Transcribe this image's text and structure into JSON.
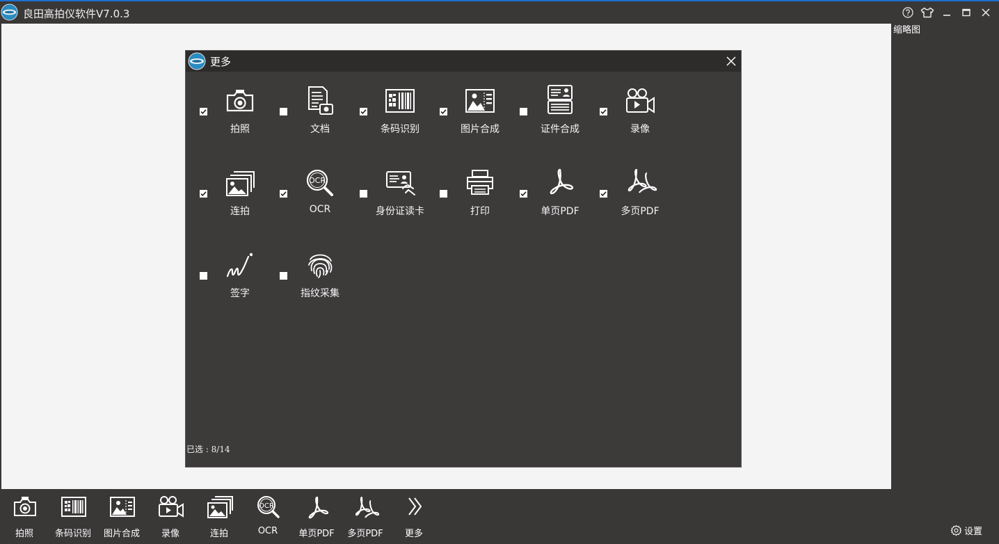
{
  "window": {
    "title": "良田高拍仪软件V7.0.3",
    "accent_color": "#1e6fd0",
    "controls": [
      "help-icon",
      "skin-icon",
      "minimize-icon",
      "maximize-icon",
      "close-icon"
    ]
  },
  "thumbnail_panel": {
    "label": "缩略图"
  },
  "toolbar": {
    "items": [
      {
        "label": "拍照",
        "icon": "camera-icon"
      },
      {
        "label": "条码识别",
        "icon": "barcode-icon"
      },
      {
        "label": "图片合成",
        "icon": "image-merge-icon"
      },
      {
        "label": "录像",
        "icon": "video-camera-icon"
      },
      {
        "label": "连拍",
        "icon": "burst-icon"
      },
      {
        "label": "OCR",
        "icon": "ocr-icon"
      },
      {
        "label": "单页PDF",
        "icon": "pdf-icon"
      },
      {
        "label": "多页PDF",
        "icon": "multi-pdf-icon"
      },
      {
        "label": "更多",
        "icon": "chevron-right-double-icon"
      }
    ],
    "settings_label": "设置"
  },
  "dialog": {
    "title": "更多",
    "status": "已选 : 8/14",
    "items": [
      {
        "label": "拍照",
        "checked": true,
        "icon": "camera-icon"
      },
      {
        "label": "文档",
        "checked": false,
        "icon": "document-camera-icon"
      },
      {
        "label": "条码识别",
        "checked": true,
        "icon": "barcode-icon"
      },
      {
        "label": "图片合成",
        "checked": true,
        "icon": "image-merge-icon"
      },
      {
        "label": "证件合成",
        "checked": false,
        "icon": "id-merge-icon"
      },
      {
        "label": "录像",
        "checked": true,
        "icon": "video-camera-icon"
      },
      {
        "label": "连拍",
        "checked": true,
        "icon": "burst-icon"
      },
      {
        "label": "OCR",
        "checked": true,
        "icon": "ocr-icon"
      },
      {
        "label": "身份证读卡",
        "checked": false,
        "icon": "id-card-reader-icon"
      },
      {
        "label": "打印",
        "checked": false,
        "icon": "printer-icon"
      },
      {
        "label": "单页PDF",
        "checked": true,
        "icon": "pdf-icon"
      },
      {
        "label": "多页PDF",
        "checked": true,
        "icon": "multi-pdf-icon"
      },
      {
        "label": "签字",
        "checked": false,
        "icon": "signature-icon"
      },
      {
        "label": "指纹采集",
        "checked": false,
        "icon": "fingerprint-icon"
      }
    ]
  }
}
